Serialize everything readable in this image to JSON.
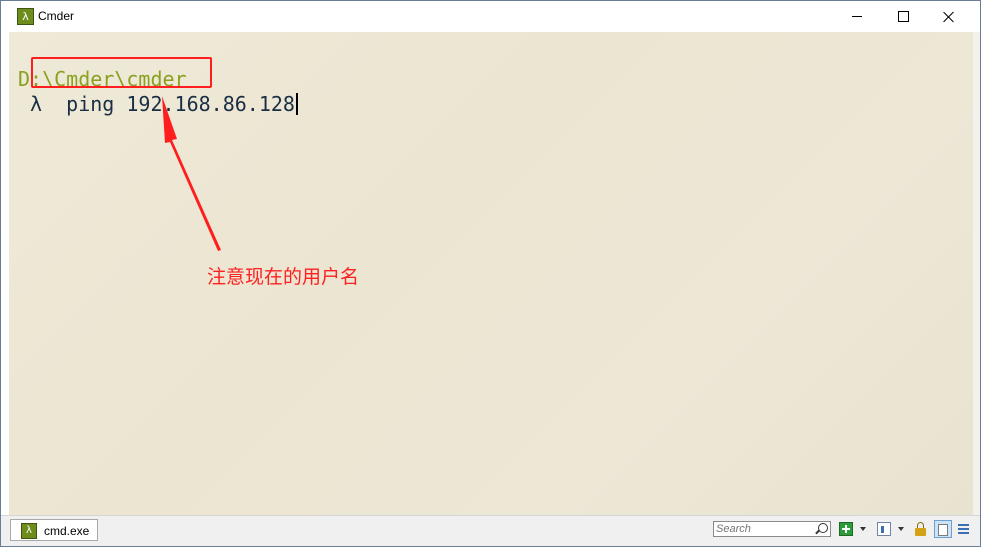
{
  "window": {
    "title": "Cmder",
    "icon": "lambda-icon"
  },
  "console": {
    "path_line": "D:\\Cmder\\cmder",
    "command_line": " λ  ping 192.168.86.128",
    "background_color": "#ede7d6",
    "path_color": "#8aa11f",
    "command_color": "#1a2e44"
  },
  "annotation": {
    "text": "注意现在的用户名",
    "color": "#ff2020"
  },
  "statusbar": {
    "tab_label": "cmd.exe",
    "tab_icon": "lambda-icon",
    "search_placeholder": "Search"
  }
}
